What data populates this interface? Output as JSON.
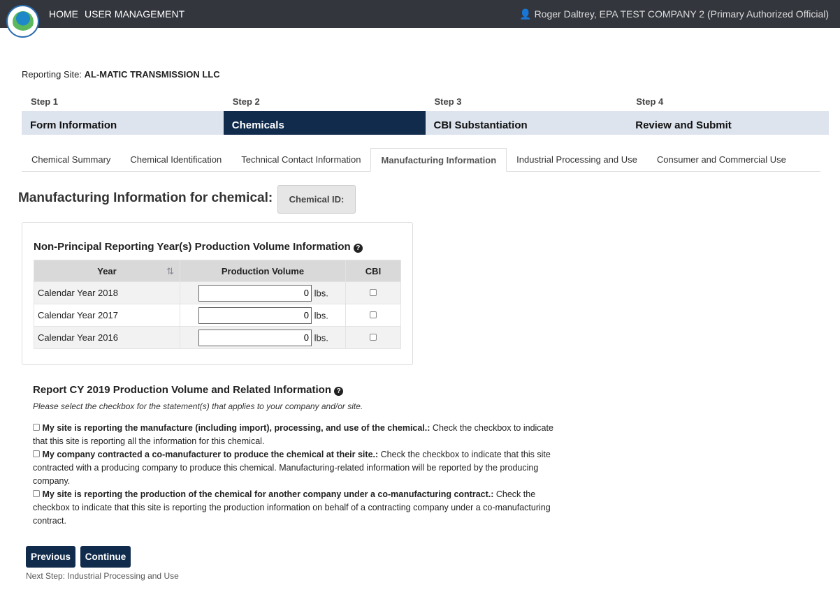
{
  "header": {
    "nav": [
      "HOME",
      "USER MANAGEMENT"
    ],
    "user": "Roger Daltrey, EPA TEST COMPANY 2 (Primary Authorized Official)"
  },
  "site": {
    "label": "Reporting Site:",
    "name": "AL-MATIC TRANSMISSION LLC"
  },
  "steps": [
    {
      "n": "Step 1",
      "t": "Form Information"
    },
    {
      "n": "Step 2",
      "t": "Chemicals"
    },
    {
      "n": "Step 3",
      "t": "CBI Substantiation"
    },
    {
      "n": "Step 4",
      "t": "Review and Submit"
    }
  ],
  "tabs": [
    "Chemical Summary",
    "Chemical Identification",
    "Technical Contact Information",
    "Manufacturing Information",
    "Industrial Processing and Use",
    "Consumer and Commercial Use"
  ],
  "title": "Manufacturing Information for chemical:",
  "chemical_id": "Chemical ID:",
  "panel": {
    "title": "Non-Principal Reporting Year(s) Production Volume Information",
    "headers": [
      "Year",
      "Production Volume",
      "CBI"
    ],
    "unit": "lbs.",
    "rows": [
      {
        "year": "Calendar Year 2018",
        "value": "0"
      },
      {
        "year": "Calendar Year 2017",
        "value": "0"
      },
      {
        "year": "Calendar Year 2016",
        "value": "0"
      }
    ]
  },
  "report": {
    "title": "Report CY 2019 Production Volume and Related Information",
    "hint": "Please select the checkbox for the statement(s) that applies to your company and/or site.",
    "statements": [
      {
        "b": "My site is reporting the manufacture (including import), processing, and use of the chemical.:",
        "t": " Check the checkbox to indicate that this site is reporting all the information for this chemical."
      },
      {
        "b": "My company contracted a co-manufacturer to produce the chemical at their site.:",
        "t": " Check the checkbox to indicate that this site contracted with a producing company to produce this chemical. Manufacturing-related information will be reported by the producing company."
      },
      {
        "b": "My site is reporting the production of the chemical for another company under a co-manufacturing contract.:",
        "t": " Check the checkbox to indicate that this site is reporting the production information on behalf of a contracting company under a co-manufacturing contract."
      }
    ]
  },
  "buttons": {
    "previous": "Previous",
    "continue": "Continue"
  },
  "next_step": "Next Step: Industrial Processing and Use"
}
